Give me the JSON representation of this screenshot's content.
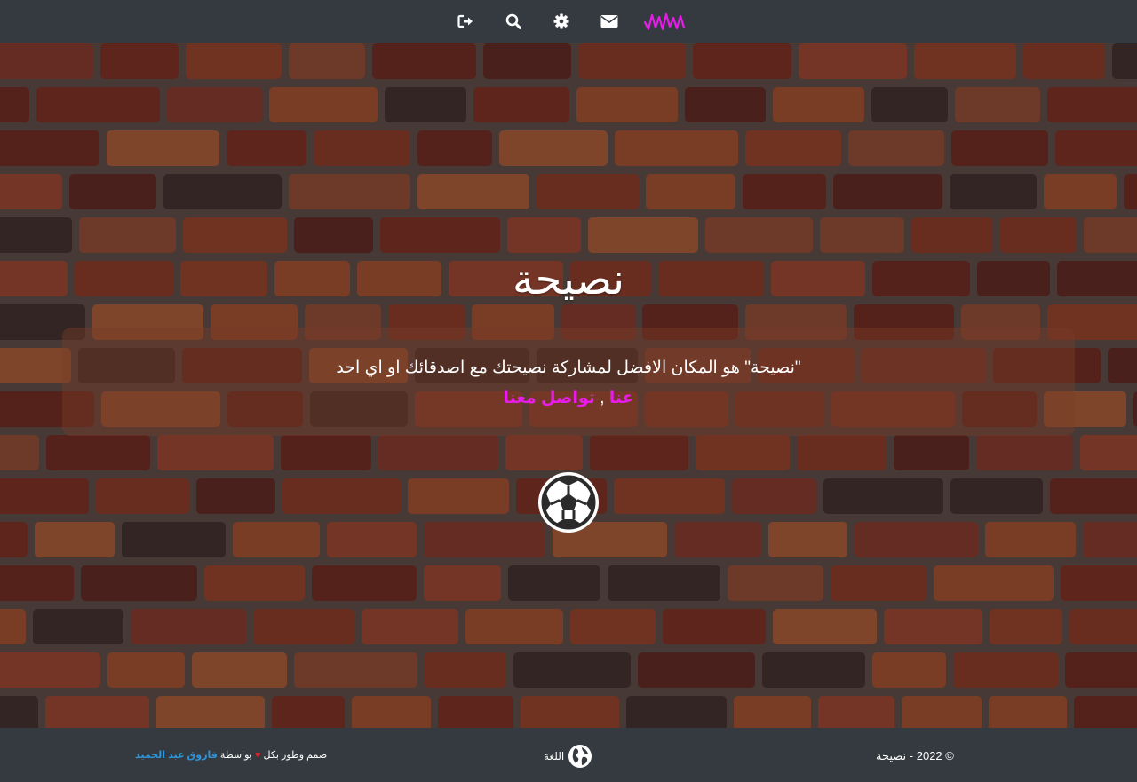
{
  "nav": {
    "icons": [
      "logout-icon",
      "search-icon",
      "gear-icon",
      "envelope-icon",
      "logo-wave-icon"
    ],
    "accent": "#e81ce8"
  },
  "hero": {
    "title": "نصيحة",
    "description": "\"نصيحة\" هو المكان الافضل لمشاركة نصيحتك مع اصدقائك او اي احد",
    "link_about": "عنا",
    "separator": ",",
    "link_contact": "تواصل معنا",
    "ball_icon": "soccer-ball-icon"
  },
  "footer": {
    "credit_prefix": "صمم وطور بكل",
    "credit_by": "بواسطة",
    "author": "فاروق عبد الحميد",
    "language": "اللغة",
    "language_icon": "globe-icon",
    "copyright": "© 2022 - نصيحة",
    "author_color": "#2f95d8",
    "heart_color": "#e0202a"
  }
}
